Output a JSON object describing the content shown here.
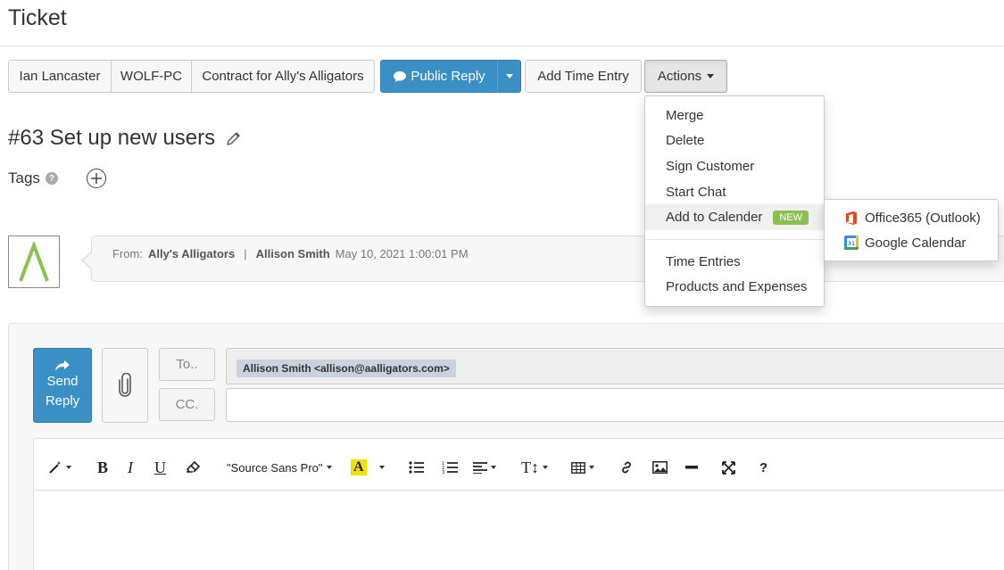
{
  "page": {
    "title": "Ticket"
  },
  "button_bar": {
    "customer": "Ian Lancaster",
    "asset": "WOLF-PC",
    "contract": "Contract for Ally's Alligators",
    "public_reply": "Public Reply",
    "add_time_entry": "Add Time Entry",
    "actions": "Actions"
  },
  "ticket": {
    "title": "#63 Set up new users",
    "tags_label": "Tags",
    "help": "?"
  },
  "message": {
    "from_label": "From:",
    "company": "Ally's Alligators",
    "separator": "|",
    "person": "Allison Smith",
    "date": "May 10, 2021 1:00:01 PM"
  },
  "reply": {
    "send_line1": "Send",
    "send_line2": "Reply",
    "to_label": "To..",
    "cc_label": "CC.",
    "to_recipient": "Allison Smith <allison@aalligators.com>",
    "font_name": "\"Source Sans Pro\"",
    "help": "?"
  },
  "actions_menu": {
    "items": [
      "Merge",
      "Delete",
      "Sign Customer",
      "Start Chat",
      "Add to Calender"
    ],
    "new_badge": "NEW",
    "items_after_divider": [
      "Time Entries",
      "Products and Expenses"
    ]
  },
  "calendar_submenu": {
    "items": [
      "Office365 (Outlook)",
      "Google Calendar"
    ]
  },
  "colors": {
    "primary": "#3a8fc4",
    "new_badge": "#8cc152",
    "logo_green": "#8cc152",
    "office_red": "#e8431c",
    "font_highlight": "#f5e100"
  }
}
